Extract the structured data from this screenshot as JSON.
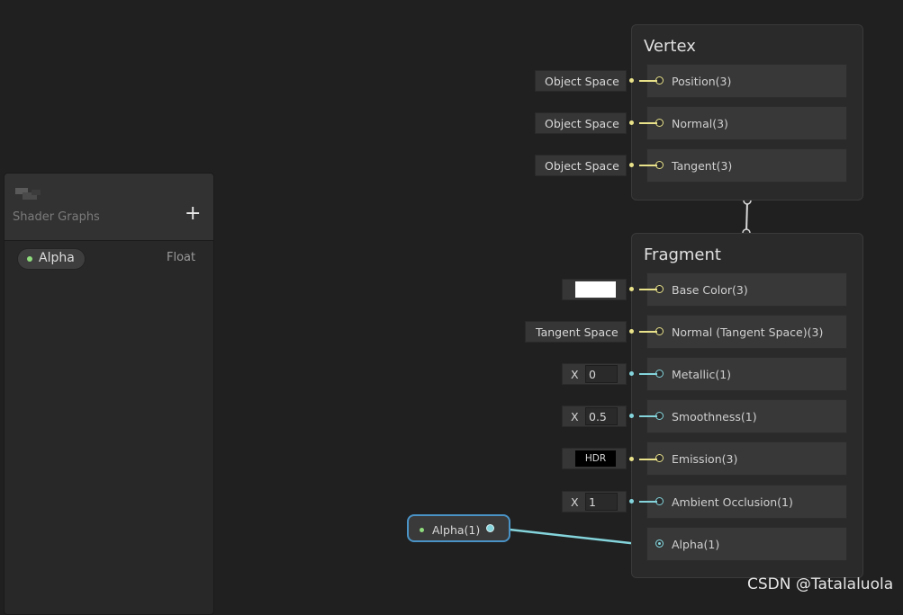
{
  "blackboard": {
    "subtitle": "Shader Graphs",
    "add_icon": "+",
    "properties": [
      {
        "name": "Alpha",
        "type": "Float"
      }
    ]
  },
  "vertex": {
    "title": "Vertex",
    "slots": [
      {
        "label": "Position(3)",
        "input": "Object Space"
      },
      {
        "label": "Normal(3)",
        "input": "Object Space"
      },
      {
        "label": "Tangent(3)",
        "input": "Object Space"
      }
    ]
  },
  "fragment": {
    "title": "Fragment",
    "slots": [
      {
        "label": "Base Color(3)",
        "input_kind": "color",
        "color": "#ffffff"
      },
      {
        "label": "Normal (Tangent Space)(3)",
        "input": "Tangent Space"
      },
      {
        "label": "Metallic(1)",
        "axis": "X",
        "value": "0"
      },
      {
        "label": "Smoothness(1)",
        "axis": "X",
        "value": "0.5"
      },
      {
        "label": "Emission(3)",
        "input_kind": "hdr",
        "hdr_label": "HDR"
      },
      {
        "label": "Ambient Occlusion(1)",
        "axis": "X",
        "value": "1"
      },
      {
        "label": "Alpha(1)"
      }
    ]
  },
  "property_node": {
    "label": "Alpha(1)"
  },
  "colors": {
    "vector3": "#e9e28a",
    "float": "#84d4dc",
    "selection": "#4a93c6"
  },
  "watermark": "CSDN @Tatalaluola"
}
